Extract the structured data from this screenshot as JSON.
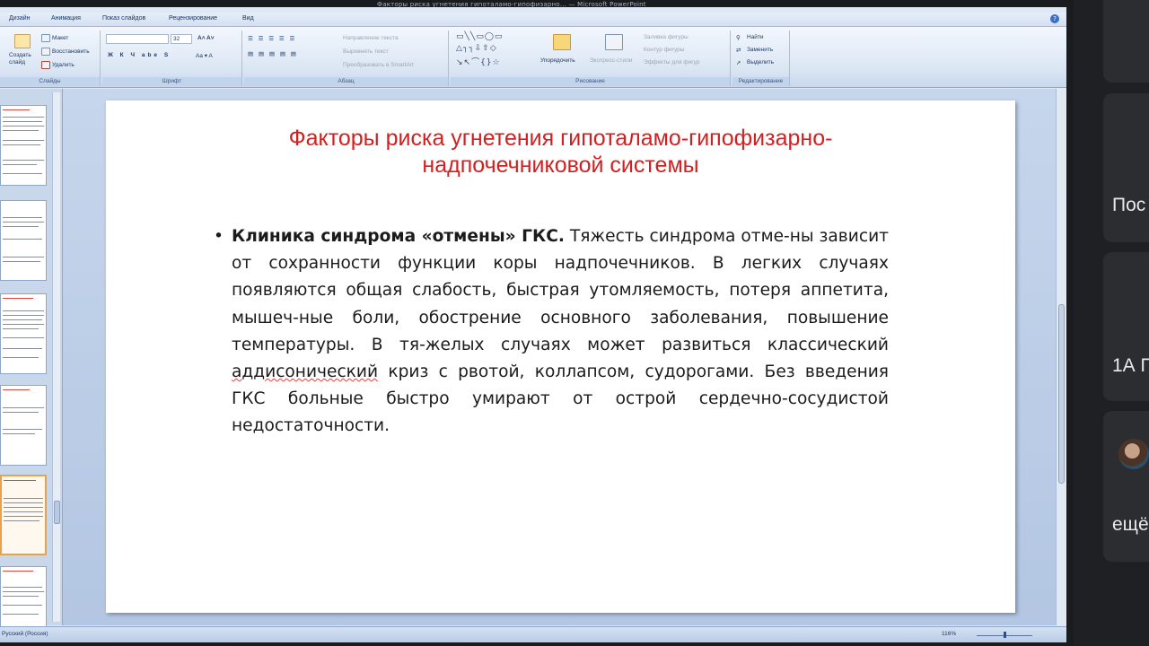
{
  "window": {
    "title": "Факторы риска угнетения гипоталамо-гипофизарно... — Microsoft PowerPoint"
  },
  "ribbon_tabs": [
    "Дизайн",
    "Анимация",
    "Показ слайдов",
    "Рецензирование",
    "Вид"
  ],
  "ribbon": {
    "slides_group": {
      "label": "Слайды",
      "create_slide": "Создать слайд",
      "layout": "Макет",
      "reset": "Восстановить",
      "delete": "Удалить"
    },
    "font_group": {
      "label": "Шрифт",
      "font_size": "32"
    },
    "paragraph_group": {
      "label": "Абзац",
      "text_direction": "Направление текста",
      "align_text": "Выровнять текст",
      "convert_smartart": "Преобразовать в SmartArt"
    },
    "drawing_group": {
      "label": "Рисование",
      "arrange": "Упорядочить",
      "quick_styles": "Экспресс-стили",
      "shape_fill": "Заливка фигуры",
      "shape_outline": "Контур фигуры",
      "shape_effects": "Эффекты для фигур"
    },
    "editing_group": {
      "label": "Редактирование",
      "find": "Найти",
      "replace": "Заменить",
      "select": "Выделить"
    }
  },
  "slide": {
    "title_line1": "Факторы риска угнетения гипоталамо-гипофизарно-",
    "title_line2": "надпочечниковой системы",
    "bullet": "•",
    "body_bold": "Клиника синдрома «отмены» ГКС.",
    "body_part1": " Тяжесть синдрома отме-ны зависит от сохранности функции коры надпочечников. В легких случаях появляются общая слабость, быстрая утомляемость, потеря аппетита, мышеч-ные боли, обострение основного заболевания, повышение температуры. В тя-желых случаях может развиться классический ",
    "body_underlined": "аддисонический",
    "body_part2": " криз с рвотой, коллапсом, судорогами. Без введения ГКС больные быстро умирают от острой сердечно-сосудистой недостаточности."
  },
  "status_bar": {
    "language": "Русский (Россия)",
    "zoom": "116%"
  },
  "side_panel": {
    "card1_text": "",
    "card2_text": "Пос",
    "card3_text": "1А П",
    "card4_text": "ещё"
  }
}
